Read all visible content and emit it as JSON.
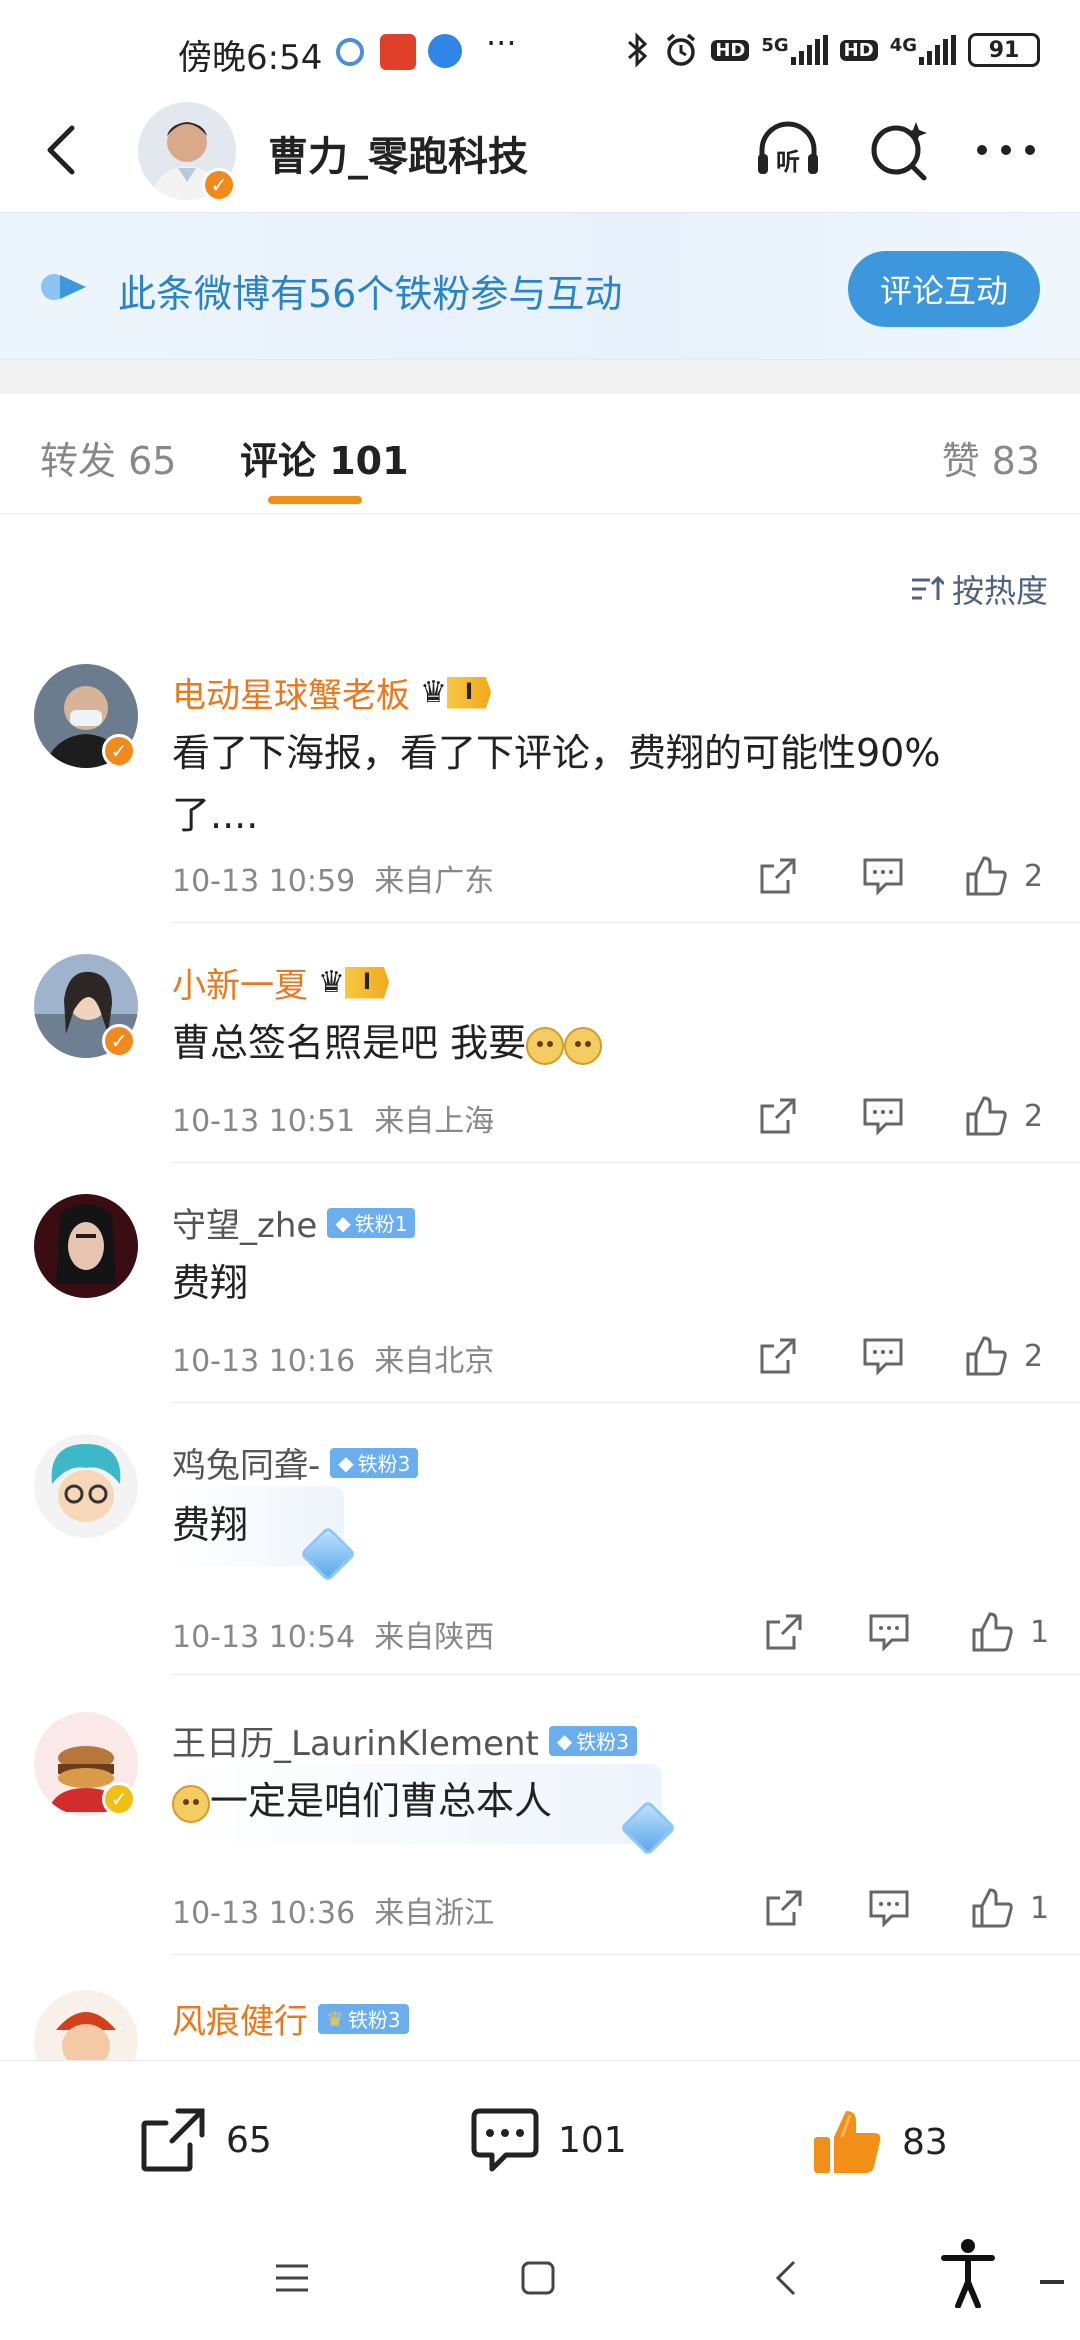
{
  "status_bar": {
    "time": "傍晚6:54",
    "net_5g": "5G",
    "net_4g": "4G",
    "hd": "HD",
    "battery": "91"
  },
  "header": {
    "title": "曹力_零跑科技",
    "listen_label": "听"
  },
  "banner": {
    "text": "此条微博有56个铁粉参与互动",
    "button": "评论互动"
  },
  "tabs": [
    {
      "label": "转发 65"
    },
    {
      "label": "评论 101"
    },
    {
      "label": "赞 83"
    }
  ],
  "sort": {
    "label": "按热度"
  },
  "comments": [
    {
      "name": "电动星球蟹老板",
      "level": "I",
      "text": "看了下海报，看了下评论，费翔的可能性90%了....",
      "time": "10-13 10:59",
      "location": "来自广东",
      "likes": "2"
    },
    {
      "name": "小新一夏",
      "level": "I",
      "text": "曹总签名照是吧 我要",
      "time": "10-13 10:51",
      "location": "来自上海",
      "likes": "2"
    },
    {
      "name": "守望_zhe",
      "badge": "铁粉1",
      "text": "费翔",
      "time": "10-13 10:16",
      "location": "来自北京",
      "likes": "2"
    },
    {
      "name": "鸡兔同聋-",
      "badge": "铁粉3",
      "text": "费翔",
      "time": "10-13 10:54",
      "location": "来自陕西",
      "likes": "1"
    },
    {
      "name": "王日历_LaurinKlement",
      "badge": "铁粉3",
      "text": "一定是咱们曹总本人",
      "time": "10-13 10:36",
      "location": "来自浙江",
      "likes": "1"
    },
    {
      "name": "风痕健行",
      "badge": "铁粉3"
    }
  ],
  "bottom_bar": {
    "reposts": "65",
    "comments": "101",
    "likes": "83"
  },
  "colors": {
    "accent_orange": "#f28f16",
    "link_blue": "#2b83c6",
    "button_blue": "#3c97dc",
    "name_orange": "#e8791e"
  }
}
